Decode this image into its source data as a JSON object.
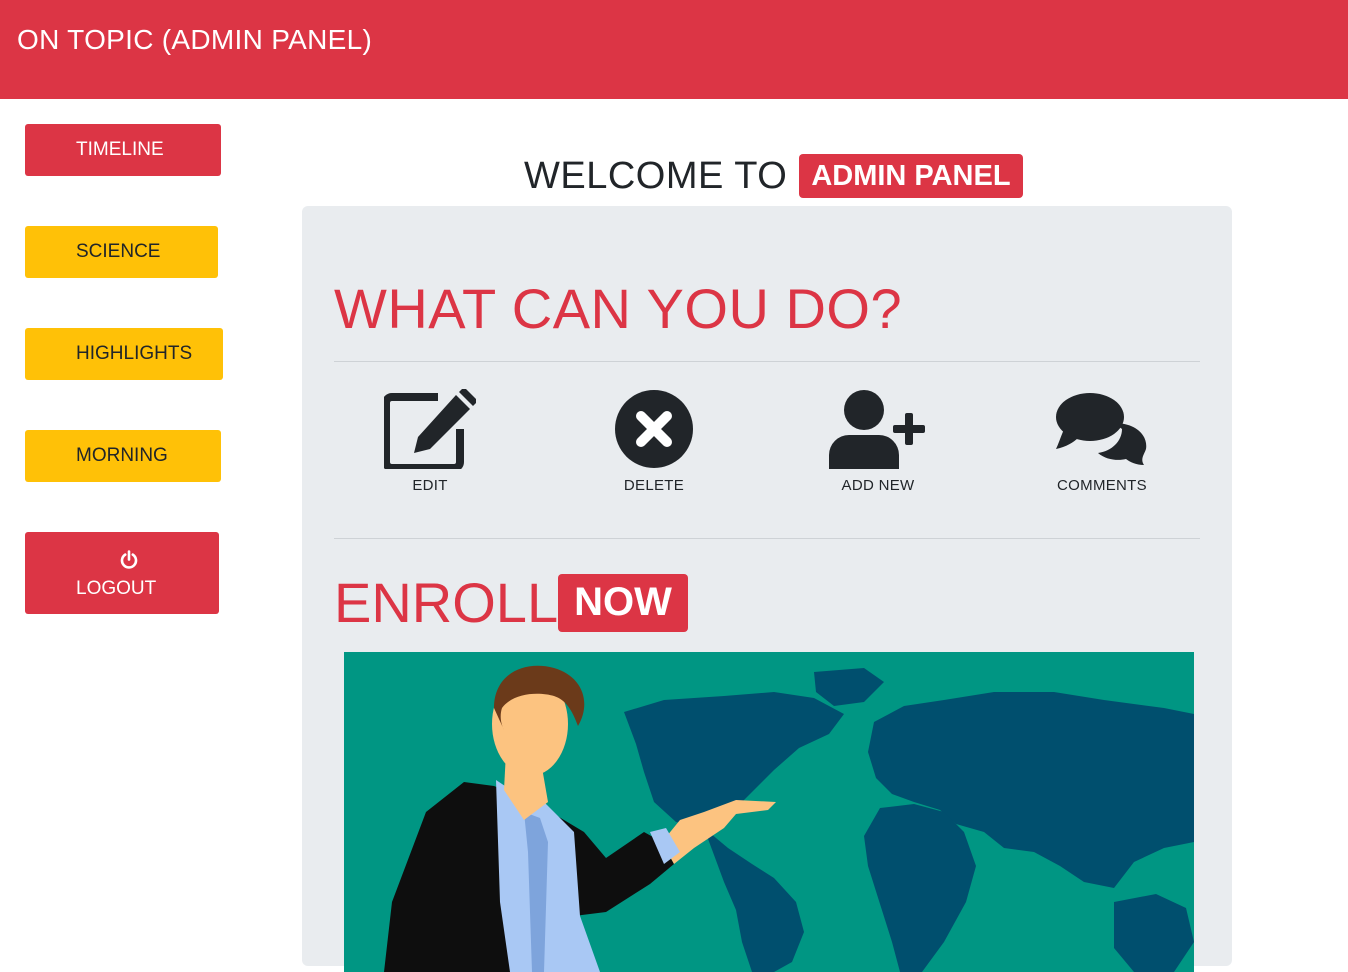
{
  "header": {
    "title": "ON TOPIC (ADMIN PANEL)"
  },
  "sidebar": {
    "items": [
      {
        "label": "TIMELINE",
        "color": "#dc3545"
      },
      {
        "label": "SCIENCE",
        "color": "#ffc107"
      },
      {
        "label": "HIGHLIGHTS",
        "color": "#ffc107"
      },
      {
        "label": "MORNING",
        "color": "#ffc107"
      }
    ],
    "logout": {
      "label": "LOGOUT",
      "icon": "power-icon"
    }
  },
  "main": {
    "welcome_text": "WELCOME TO",
    "welcome_badge": "ADMIN PANEL",
    "panel_title": "WHAT CAN YOU DO?",
    "actions": [
      {
        "label": "EDIT",
        "icon": "edit-icon"
      },
      {
        "label": "DELETE",
        "icon": "delete-icon"
      },
      {
        "label": "ADD NEW",
        "icon": "add-user-icon"
      },
      {
        "label": "COMMENTS",
        "icon": "comments-icon"
      }
    ],
    "enroll_text": "ENROLL",
    "enroll_badge": "NOW"
  },
  "colors": {
    "primary": "#dc3545",
    "warning": "#ffc107",
    "panel_bg": "#e9ecef",
    "hero_bg": "#009683",
    "map": "#004f6e"
  }
}
